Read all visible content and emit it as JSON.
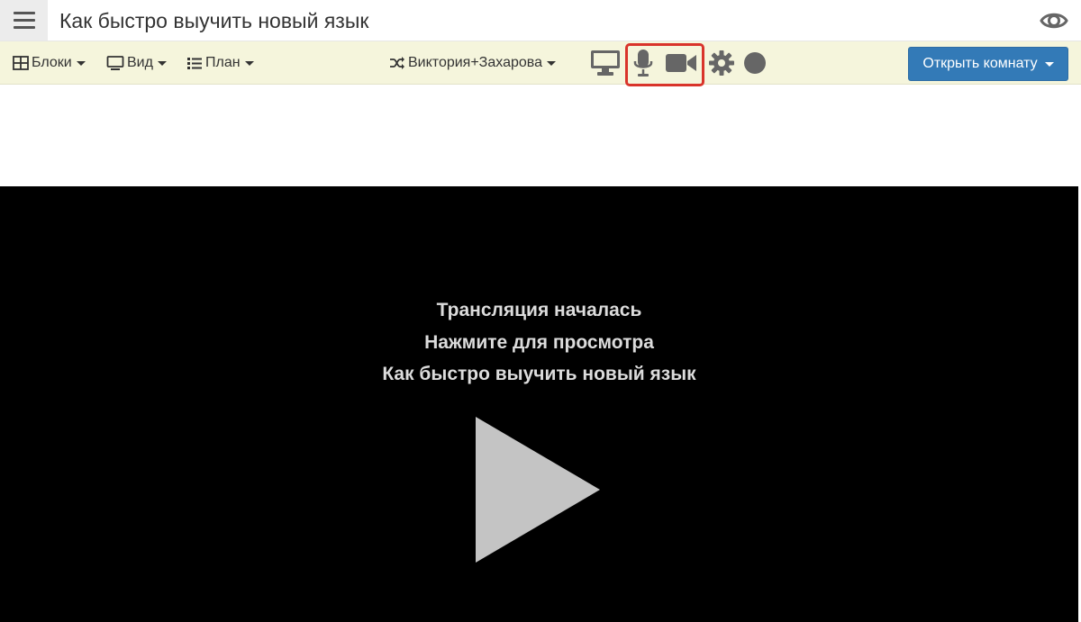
{
  "header": {
    "title": "Как быстро выучить новый язык"
  },
  "toolbar": {
    "blocks_label": "Блоки",
    "view_label": "Вид",
    "plan_label": "План",
    "presenter_label": "Виктория+Захарова",
    "open_room_label": "Открыть комнату"
  },
  "icons": {
    "menu": "hamburger-menu-icon",
    "eye": "eye-icon",
    "screen": "monitor-icon",
    "mic": "microphone-icon",
    "camera": "video-camera-icon",
    "settings": "gear-icon",
    "record": "record-circle-icon"
  },
  "colors": {
    "toolbar_bg": "#f5f5dc",
    "accent_blue": "#337ab7",
    "highlight_red": "#d9342b",
    "video_bg": "#000000",
    "icon_gray": "#666666"
  },
  "video": {
    "line1": "Трансляция началась",
    "line2": "Нажмите для просмотра",
    "line3": "Как быстро выучить новый язык"
  }
}
